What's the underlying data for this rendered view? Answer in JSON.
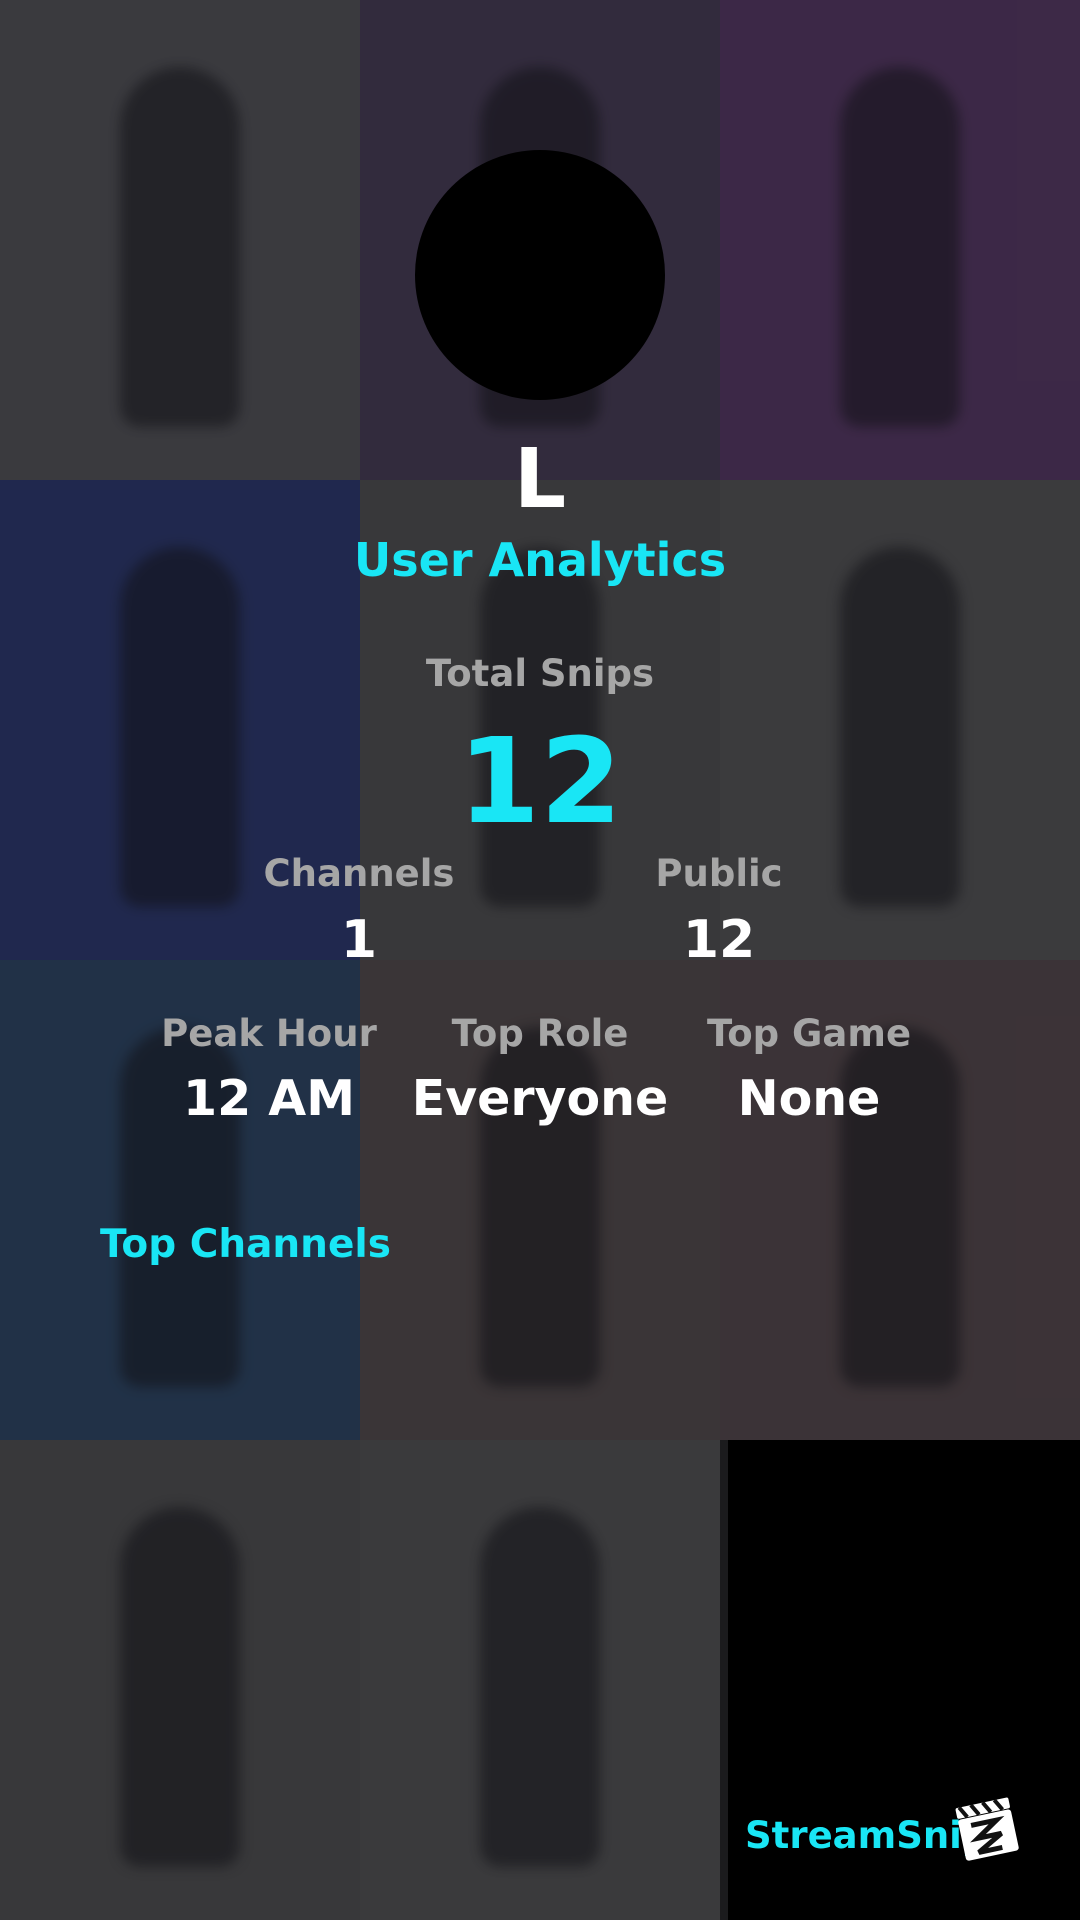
{
  "profile": {
    "name": "L",
    "subtitle": "User Analytics"
  },
  "stats": {
    "total_snips_label": "Total Snips",
    "total_snips_value": "12",
    "channels_label": "Channels",
    "channels_value": "1",
    "public_label": "Public",
    "public_value": "12",
    "peak_hour_label": "Peak Hour",
    "peak_hour_value": "12 AM",
    "top_role_label": "Top Role",
    "top_role_value": "Everyone",
    "top_game_label": "Top Game",
    "top_game_value": "None"
  },
  "sections": {
    "top_channels": "Top Channels"
  },
  "brand": {
    "name": "StreamSnip",
    "icon": "clapperboard-icon"
  },
  "colors": {
    "accent": "#19e6f5",
    "label": "#a6a6a6",
    "value": "#ffffff"
  }
}
